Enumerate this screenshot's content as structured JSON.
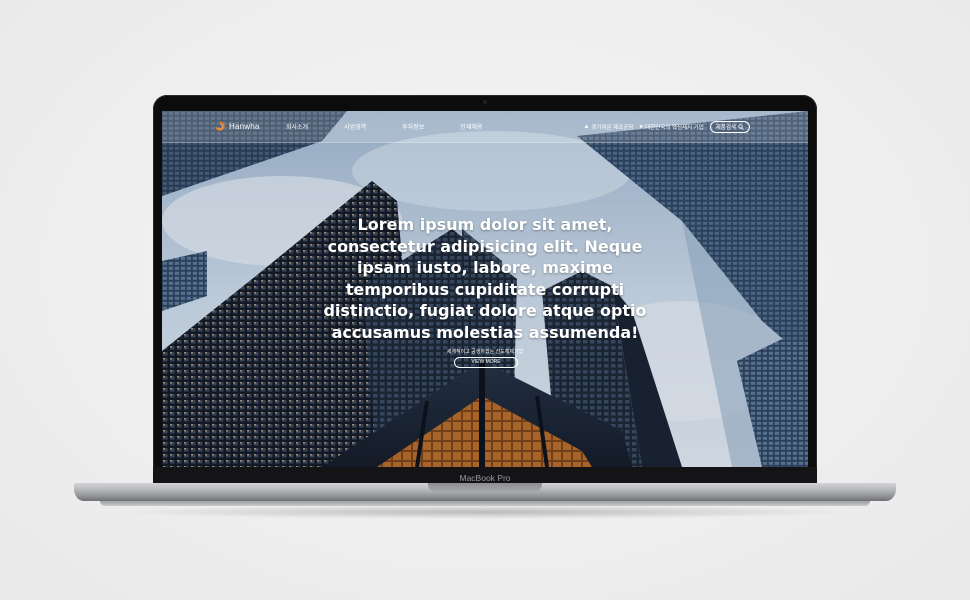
{
  "device": {
    "model_label": "MacBook Pro"
  },
  "site": {
    "logo_text": "Hanwha",
    "nav": [
      "회사소개",
      "사업영역",
      "투자정보",
      "인재채용"
    ],
    "util_links": [
      {
        "icon": "factory-icon",
        "label": "경기여운 제조공장"
      },
      {
        "icon": "globe-icon",
        "label": "대한민국의 혁신제지 기업"
      }
    ],
    "search_label": "제품검색",
    "hero": {
      "headline": "Lorem ipsum dolor sit amet, consectetur adipisicing elit. Neque ipsam iusto, labore, maxime temporibus cupiditate corrupti distinctio, fugiat dolore atque optio accusamus molestias assumenda!",
      "subline": "세계적이고 공생하겠는 선도체제기업",
      "cta_label": "VIEW MORE"
    }
  },
  "colors": {
    "page_background": "#efefef",
    "bezel": "#0c0c0d",
    "aluminum": "#b9babd",
    "logo_accent": "#e37a2c",
    "sky": "#b7c9dc"
  }
}
